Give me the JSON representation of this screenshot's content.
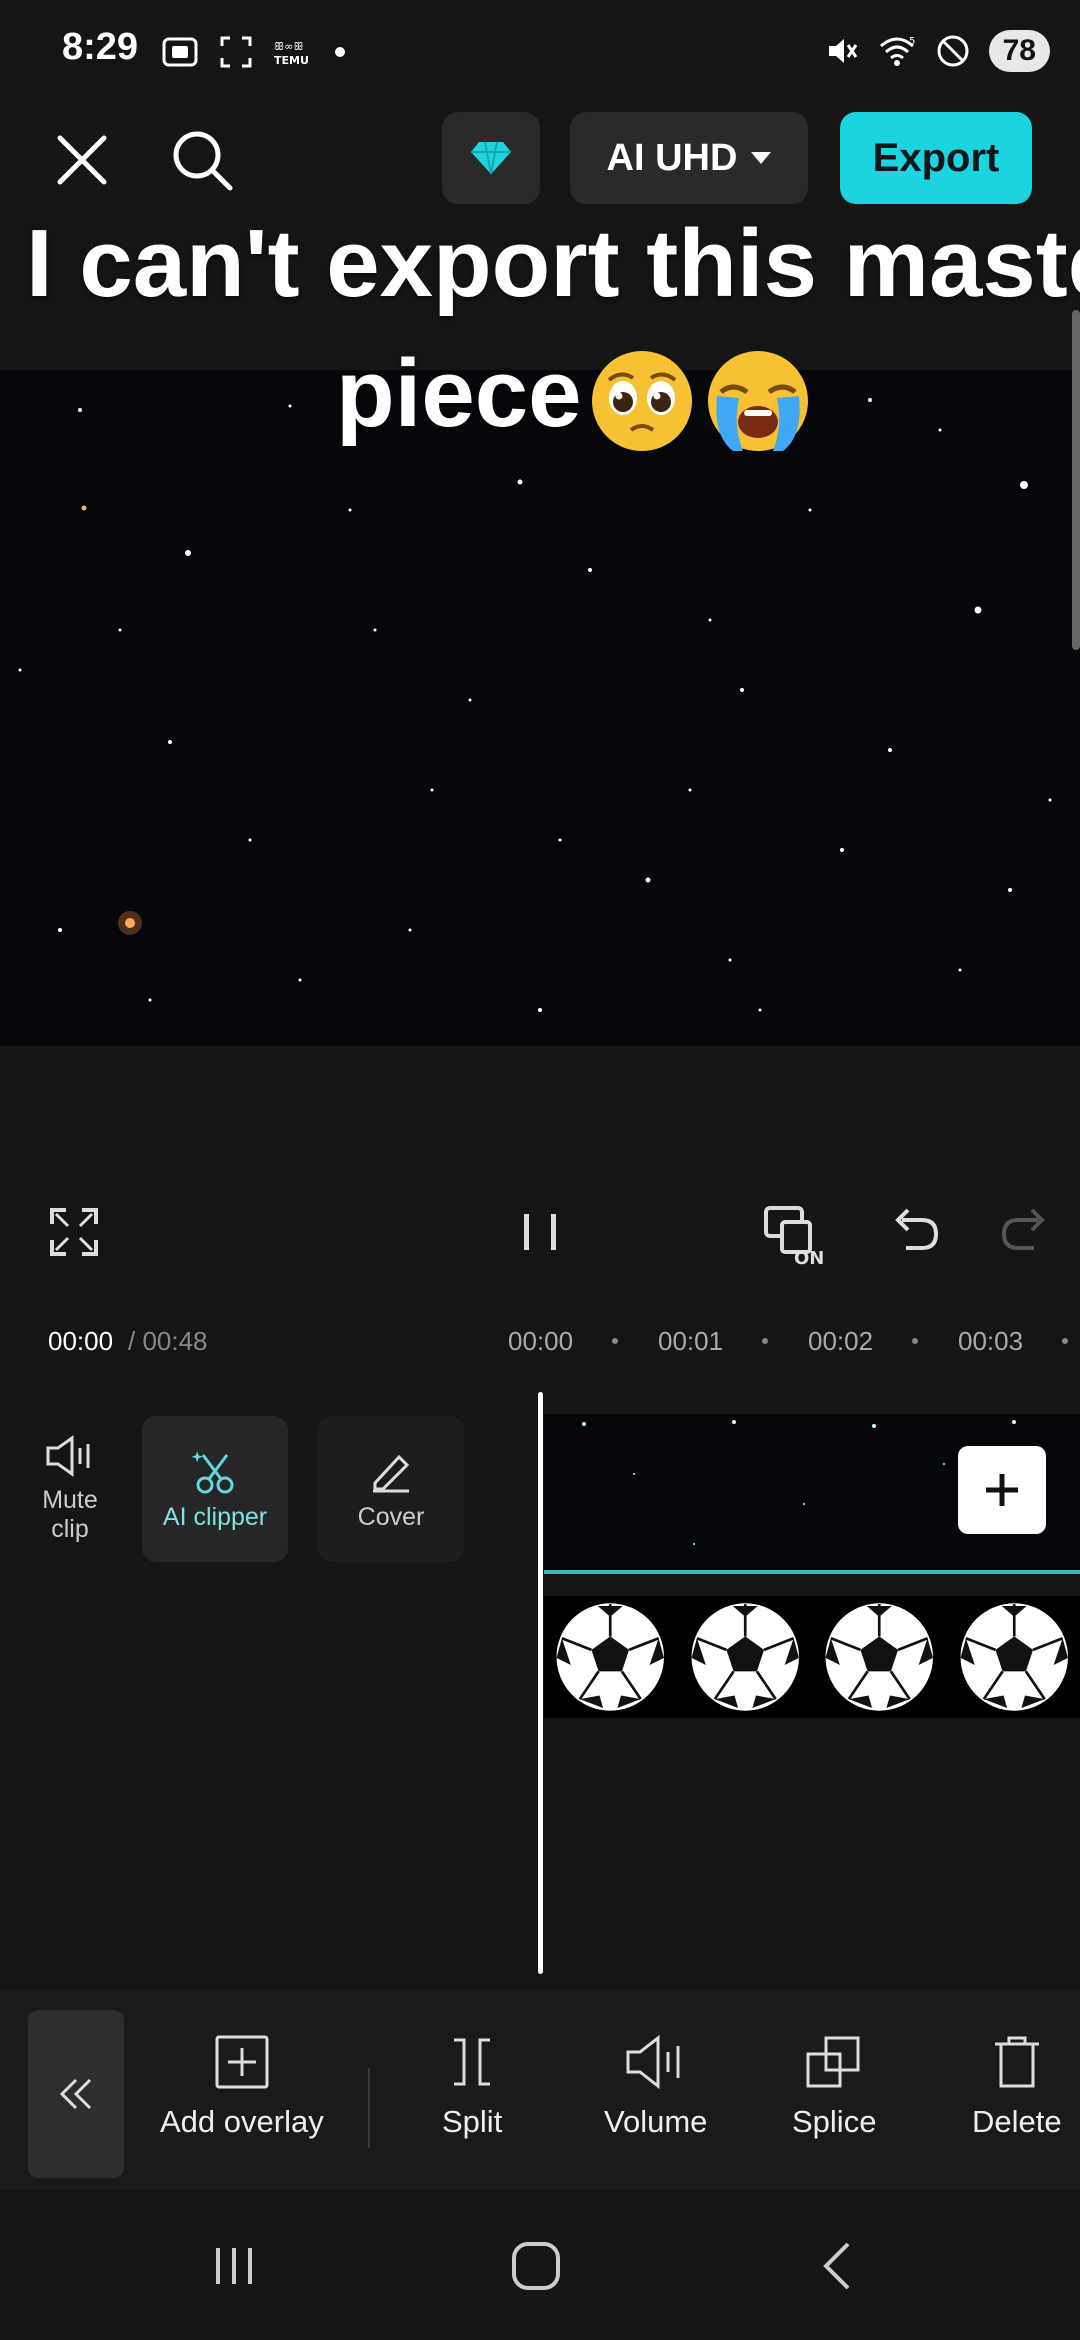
{
  "status_bar": {
    "time": "8:29",
    "battery": "78",
    "left_icons": [
      "screen-record-icon",
      "screenshot-icon",
      "temu-notification-icon",
      "notification-dot-icon"
    ],
    "right_icons": [
      "mute-icon",
      "wifi-icon",
      "do-not-disturb-icon",
      "battery-icon"
    ]
  },
  "top_bar": {
    "quality_label": "AI UHD",
    "export_label": "Export",
    "accent_color": "#1cd4e0"
  },
  "preview": {
    "caption_line1": "I can't export this maste",
    "caption_line2": "piece"
  },
  "timeline": {
    "current_time": "00:00",
    "total_time": "/ 00:48",
    "ruler_ticks": [
      "00:00",
      "00:01",
      "00:02",
      "00:03"
    ]
  },
  "track_tools": {
    "mute_label_line1": "Mute",
    "mute_label_line2": "clip",
    "ai_clipper_label": "AI clipper",
    "cover_label": "Cover"
  },
  "toolbar": {
    "items": [
      {
        "label": "Add overlay",
        "icon": "add-overlay-icon"
      },
      {
        "label": "Split",
        "icon": "split-icon"
      },
      {
        "label": "Volume",
        "icon": "volume-icon"
      },
      {
        "label": "Splice",
        "icon": "splice-icon"
      },
      {
        "label": "Delete",
        "icon": "delete-icon"
      }
    ]
  }
}
